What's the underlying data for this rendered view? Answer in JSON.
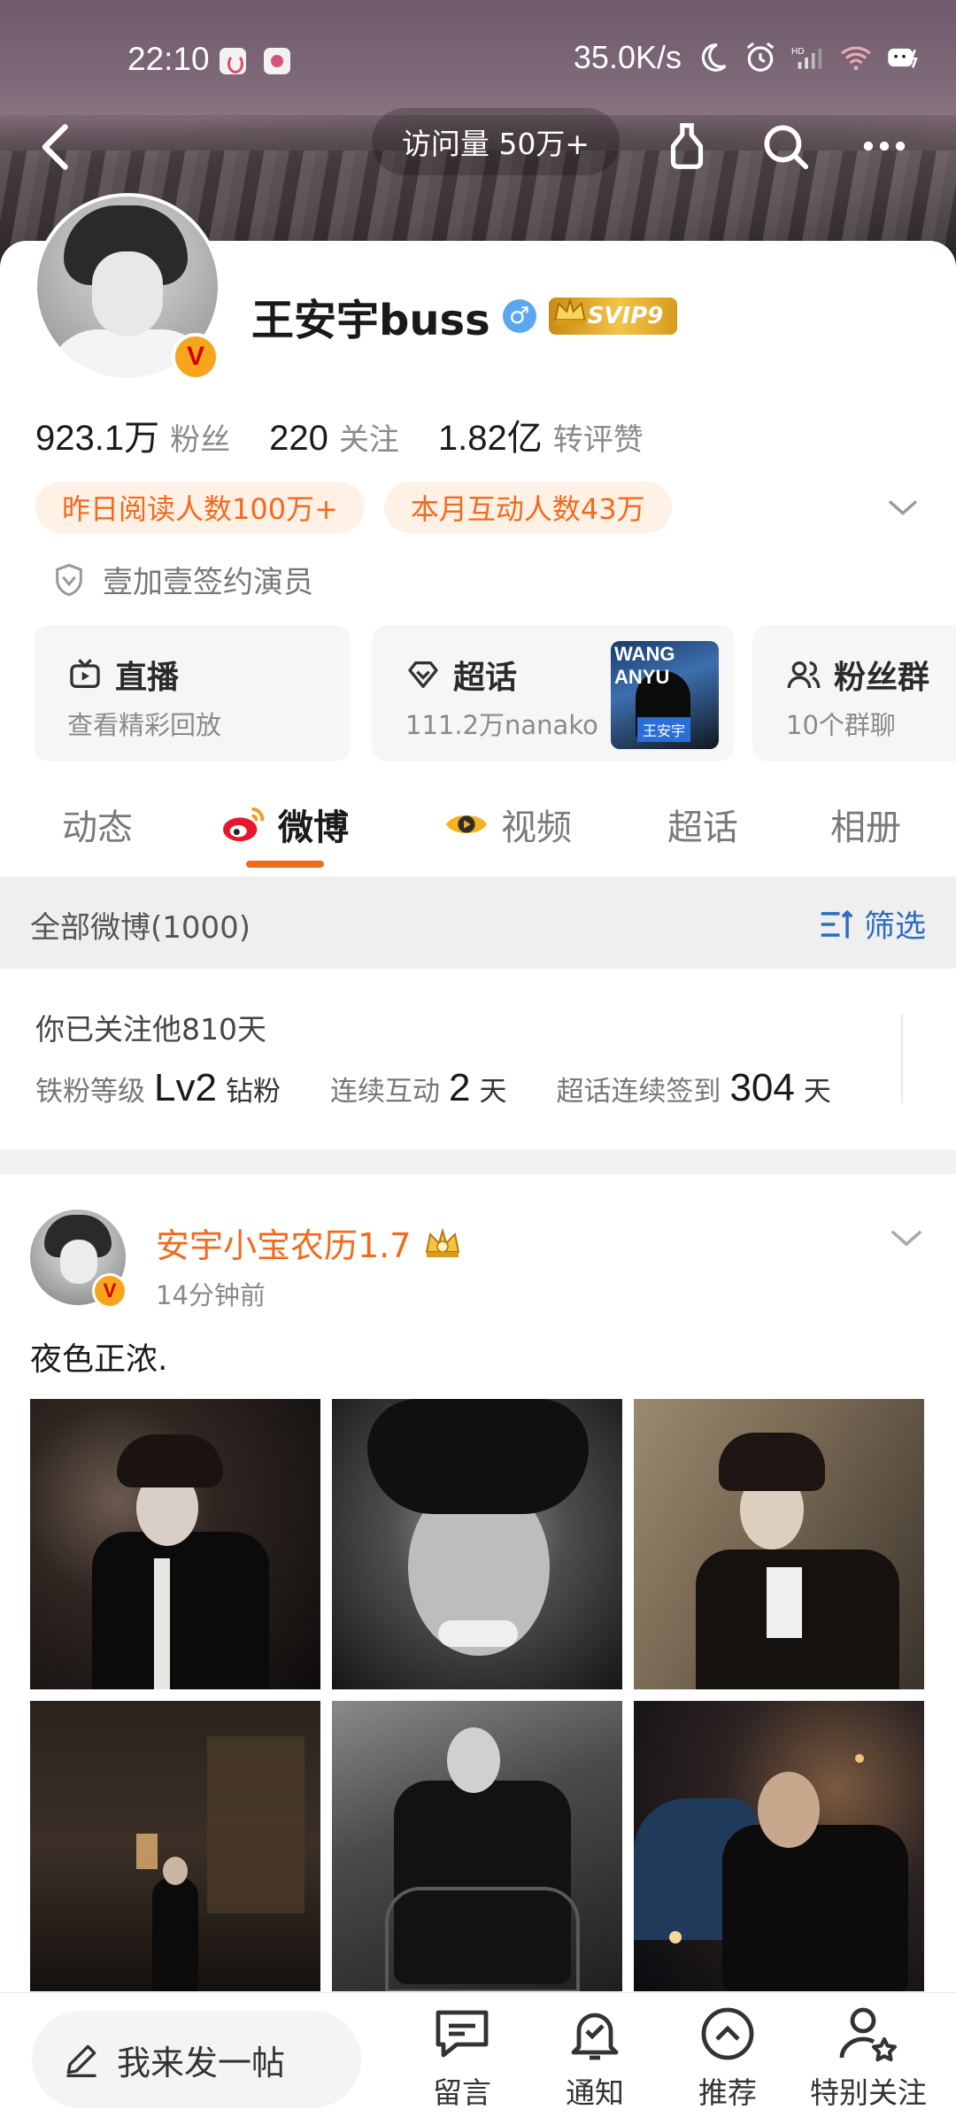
{
  "status_bar": {
    "time": "22:10",
    "network_speed": "35.0K/s",
    "icons": [
      "moon-icon",
      "alarm-icon",
      "hd-signal-icon",
      "wifi-icon",
      "battery-icon"
    ]
  },
  "top_nav": {
    "visits": "访问量 50万+",
    "icons": [
      "back-icon",
      "bottle-icon",
      "search-icon",
      "more-icon"
    ]
  },
  "profile": {
    "username": "王安宇buss",
    "gender_symbol": "♂",
    "svip_label": "SVIP9",
    "verified_symbol": "V",
    "stats": [
      {
        "value": "923.1万",
        "label": "粉丝"
      },
      {
        "value": "220",
        "label": "关注"
      },
      {
        "value": "1.82亿",
        "label": "转评赞"
      }
    ],
    "tags": [
      "昨日阅读人数100万+",
      "本月互动人数43万"
    ],
    "sign": "壹加壹签约演员"
  },
  "entries": [
    {
      "title": "直播",
      "subtitle": "查看精彩回放",
      "icon": "tv-icon"
    },
    {
      "title": "超话",
      "subtitle": "111.2万nanako",
      "icon": "diamond-icon",
      "thumb_text": "WANG ANYU",
      "thumb_name": "王安宇"
    },
    {
      "title": "粉丝群",
      "subtitle": "10个群聊",
      "icon": "group-icon"
    }
  ],
  "tabs": [
    {
      "label": "动态",
      "active": false
    },
    {
      "label": "微博",
      "active": true
    },
    {
      "label": "视频",
      "active": false
    },
    {
      "label": "超话",
      "active": false
    },
    {
      "label": "相册",
      "active": false
    }
  ],
  "filter": {
    "title": "全部微博(1000)",
    "button": "筛选"
  },
  "fan_info": {
    "follow_days": "你已关注他810天",
    "level_label": "铁粉等级",
    "level_value": "Lv2",
    "level_suffix": "钻粉",
    "interact_label": "连续互动",
    "interact_value": "2",
    "interact_suffix": "天",
    "checkin_label": "超话连续签到",
    "checkin_value": "304",
    "checkin_suffix": "天"
  },
  "post": {
    "author": "安宇小宝农历1.7",
    "time": "14分钟前",
    "text": "夜色正浓."
  },
  "bottom_bar": {
    "compose": "我来发一帖",
    "buttons": [
      "留言",
      "通知",
      "推荐",
      "特别关注"
    ]
  },
  "colors": {
    "accent": "#f26a1b",
    "link": "#2c6cc4",
    "verified": "#f7a51c"
  }
}
